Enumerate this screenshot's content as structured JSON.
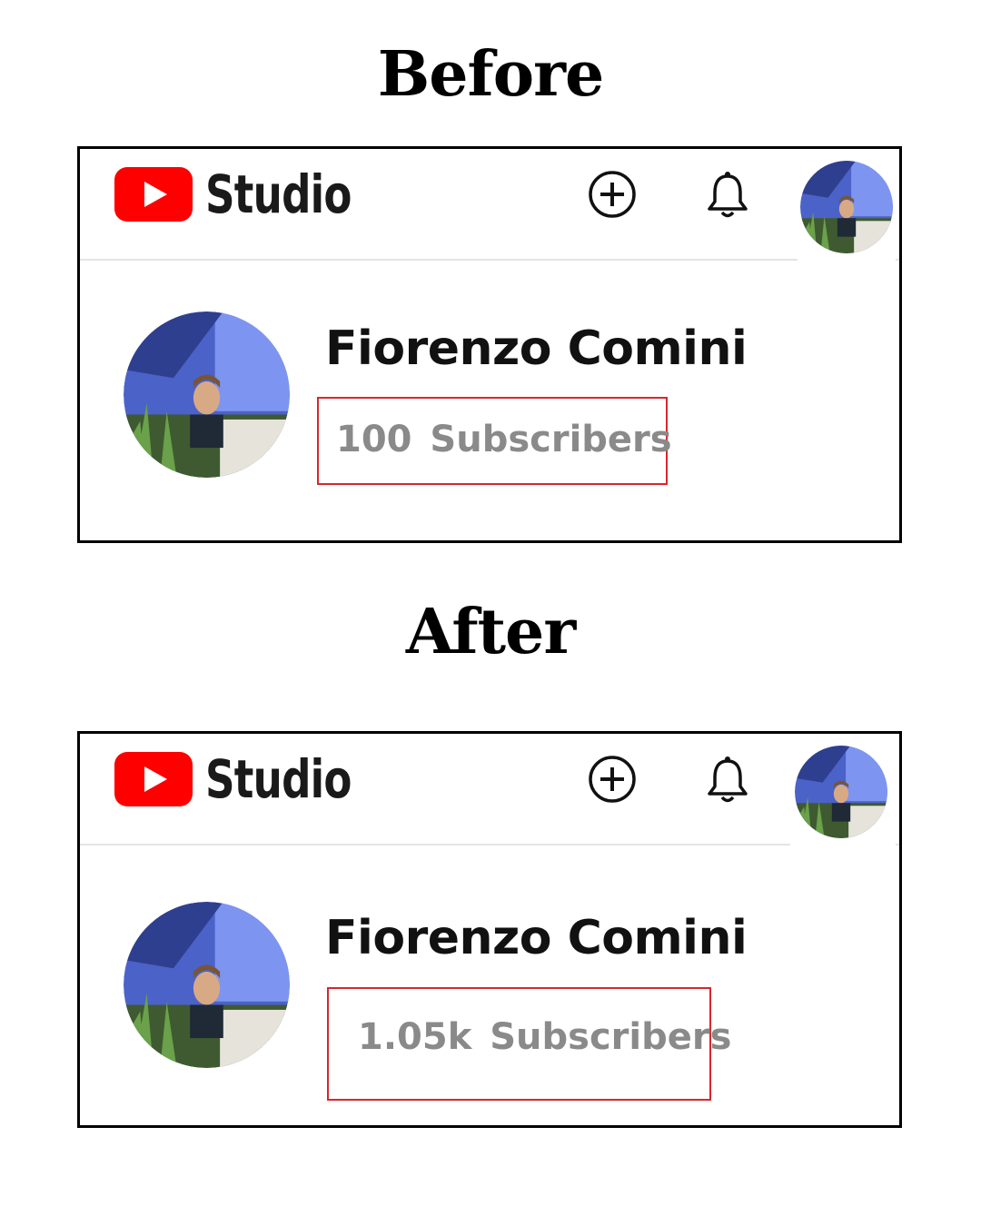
{
  "headings": {
    "before": "Before",
    "after": "After"
  },
  "app": {
    "name": "Studio"
  },
  "icons": {
    "logo": "youtube-play-icon",
    "create": "plus-circle-icon",
    "notifications": "bell-icon",
    "avatar": "profile-photo"
  },
  "colors": {
    "youtube_red": "#ff0000",
    "highlight_box": "#d9262c",
    "subscriber_text": "#8a8a8a"
  },
  "before": {
    "channel_name": "Fiorenzo Comini",
    "subscribers": "100  Subscribers"
  },
  "after": {
    "channel_name": "Fiorenzo Comini",
    "subscribers": "1.05k  Subscribers"
  }
}
